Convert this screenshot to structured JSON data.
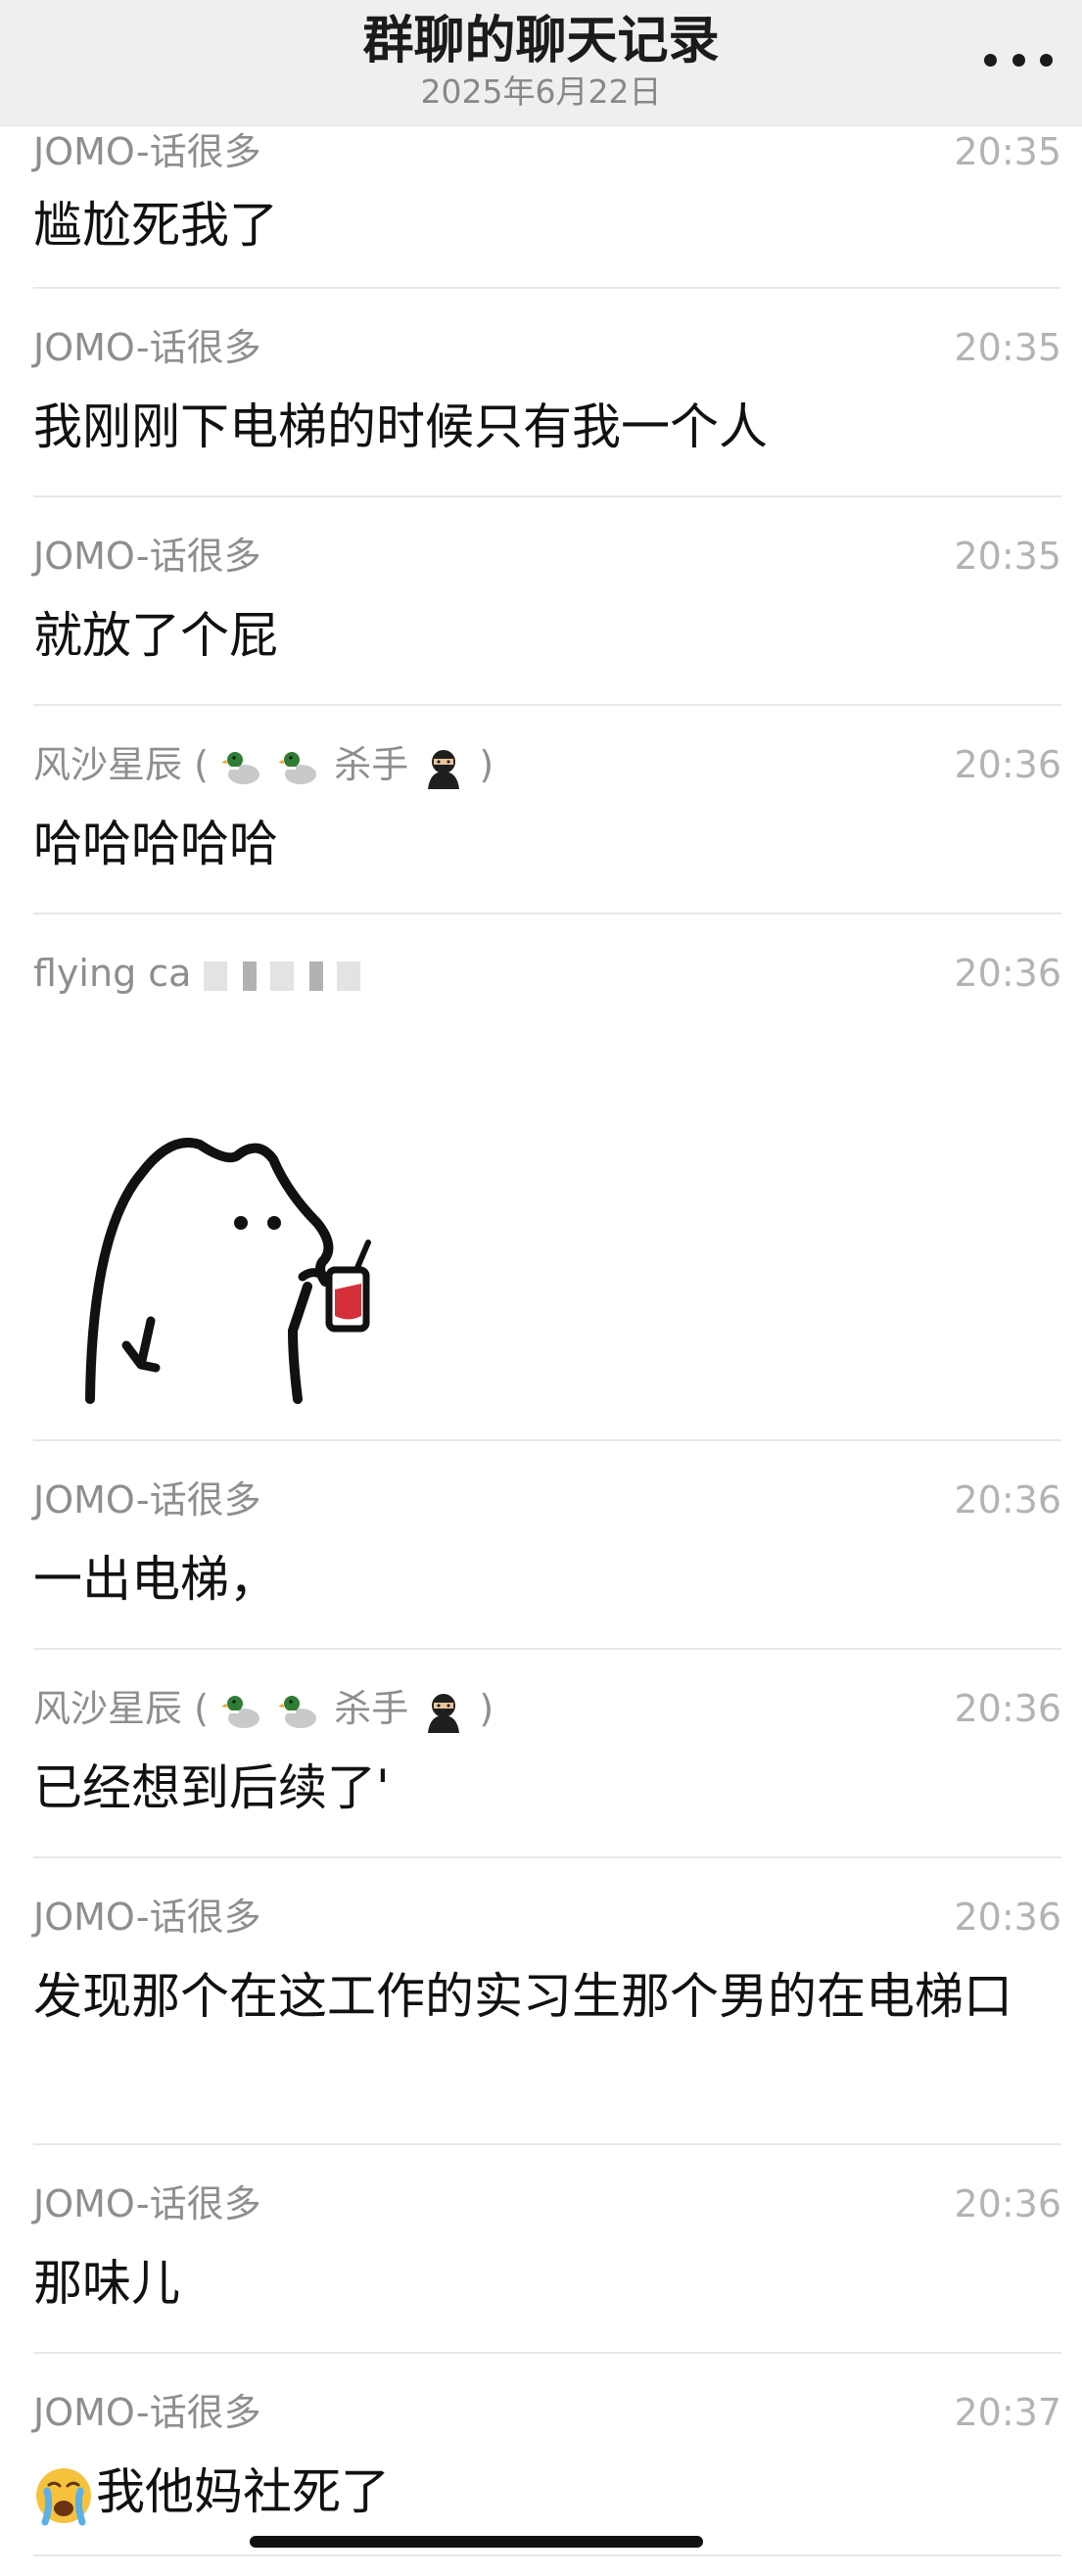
{
  "header": {
    "title": "群聊的聊天记录",
    "date": "2025年6月22日",
    "more_icon": "more-horizontal-icon"
  },
  "messages": [
    {
      "sender": "JOMO-话很多",
      "time": "20:35",
      "text": "尴尬死我了"
    },
    {
      "sender": "JOMO-话很多",
      "time": "20:35",
      "text": "我刚刚下电梯的时候只有我一个人"
    },
    {
      "sender": "JOMO-话很多",
      "time": "20:35",
      "text": "就放了个屁"
    },
    {
      "sender": "风沙星辰 (",
      "sender_tail": "杀手",
      "sender_close": ")",
      "sender_emoji": [
        "duck-icon",
        "duck-icon",
        "ninja-icon"
      ],
      "time": "20:36",
      "text": "哈哈哈哈哈"
    },
    {
      "sender": "flying ca",
      "time": "20:36",
      "sticker": "bear-drinking-sticker"
    },
    {
      "sender": "JOMO-话很多",
      "time": "20:36",
      "text": "一出电梯，"
    },
    {
      "sender": "风沙星辰 (",
      "sender_tail": "杀手",
      "sender_close": ")",
      "sender_emoji": [
        "duck-icon",
        "duck-icon",
        "ninja-icon"
      ],
      "time": "20:36",
      "text": "已经想到后续了'"
    },
    {
      "sender": "JOMO-话很多",
      "time": "20:36",
      "text": "发现那个在这工作的实习生那个男的在电梯口"
    },
    {
      "sender": "JOMO-话很多",
      "time": "20:36",
      "text": "那味儿"
    },
    {
      "sender": "JOMO-话很多",
      "time": "20:37",
      "text": "我他妈社死了",
      "text_emoji": "crying-face-icon"
    }
  ]
}
